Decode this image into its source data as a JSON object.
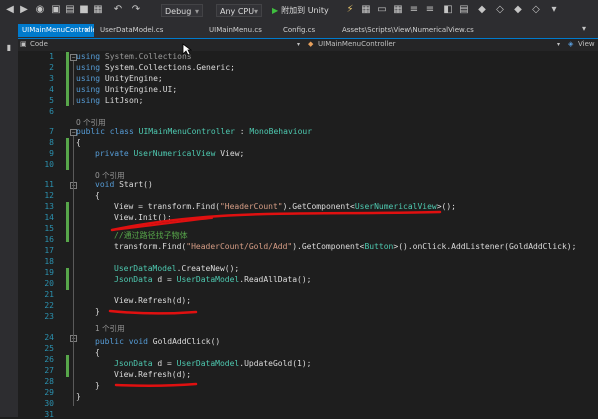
{
  "toolbar": {
    "config": "Debug",
    "platform": "Any CPU",
    "attach": "附加到 Unity"
  },
  "tabs": [
    {
      "label": "UIMainMenuController.cs"
    },
    {
      "label": "UserDataModel.cs"
    },
    {
      "label": "UIMainMenu.cs"
    },
    {
      "label": "Config.cs"
    },
    {
      "label": "Assets\\Scripts\\View\\NumericalView.cs"
    }
  ],
  "nav": {
    "project": "Code",
    "class": "UIMainMenuController",
    "member": "View"
  },
  "refs": {
    "class": "0 个引用",
    "start": "0 个引用",
    "gold": "1 个引用"
  },
  "code": {
    "l1a": "using ",
    "l1b": "System.Collections",
    "l2a": "using ",
    "l2b": "System.Collections.Generic;",
    "l3a": "using ",
    "l3b": "UnityEngine;",
    "l4a": "using ",
    "l4b": "UnityEngine.UI;",
    "l5a": "using ",
    "l5b": "LitJson;",
    "l7a": "public class ",
    "l7b": "UIMainMenuController",
    "l7c": " : ",
    "l7d": "MonoBehaviour",
    "l8": "{",
    "l9a": "private ",
    "l9b": "UserNumericalView",
    "l9c": " View;",
    "l11a": "void ",
    "l11b": "Start()",
    "l12": "{",
    "l13a": "View = transform.Find(",
    "l13b": "\"HeaderCount\"",
    "l13c": ").GetComponent<",
    "l13d": "UserNumericalView",
    "l13e": ">();",
    "l14": "View.Init();",
    "l15": "//通过路径找子物体",
    "l16a": "transform.Find(",
    "l16b": "\"HeaderCount/Gold/Add\"",
    "l16c": ").GetComponent<",
    "l16d": "Button",
    "l16e": ">().onClick.AddListener(GoldAddClick);",
    "l18a": "UserDataModel",
    "l18b": ".CreateNew();",
    "l19a": "JsonData",
    "l19b": " d = ",
    "l19c": "UserDataModel",
    "l19d": ".ReadAllData();",
    "l21": "View.Refresh(d);",
    "l22": "}",
    "l24a": "public void ",
    "l24b": "GoldAddClick()",
    "l25": "{",
    "l26a": "JsonData",
    "l26b": " d = ",
    "l26c": "UserDataModel",
    "l26d": ".UpdateGold(1);",
    "l27": "View.Refresh(d);",
    "l28": "}",
    "l29": "}"
  },
  "lines": [
    "1",
    "2",
    "3",
    "4",
    "5",
    "6",
    "7",
    "8",
    "9",
    "10",
    "11",
    "12",
    "13",
    "14",
    "15",
    "16",
    "17",
    "18",
    "19",
    "20",
    "21",
    "22",
    "23",
    "24",
    "25",
    "26",
    "27",
    "28",
    "29",
    "30",
    "31"
  ]
}
